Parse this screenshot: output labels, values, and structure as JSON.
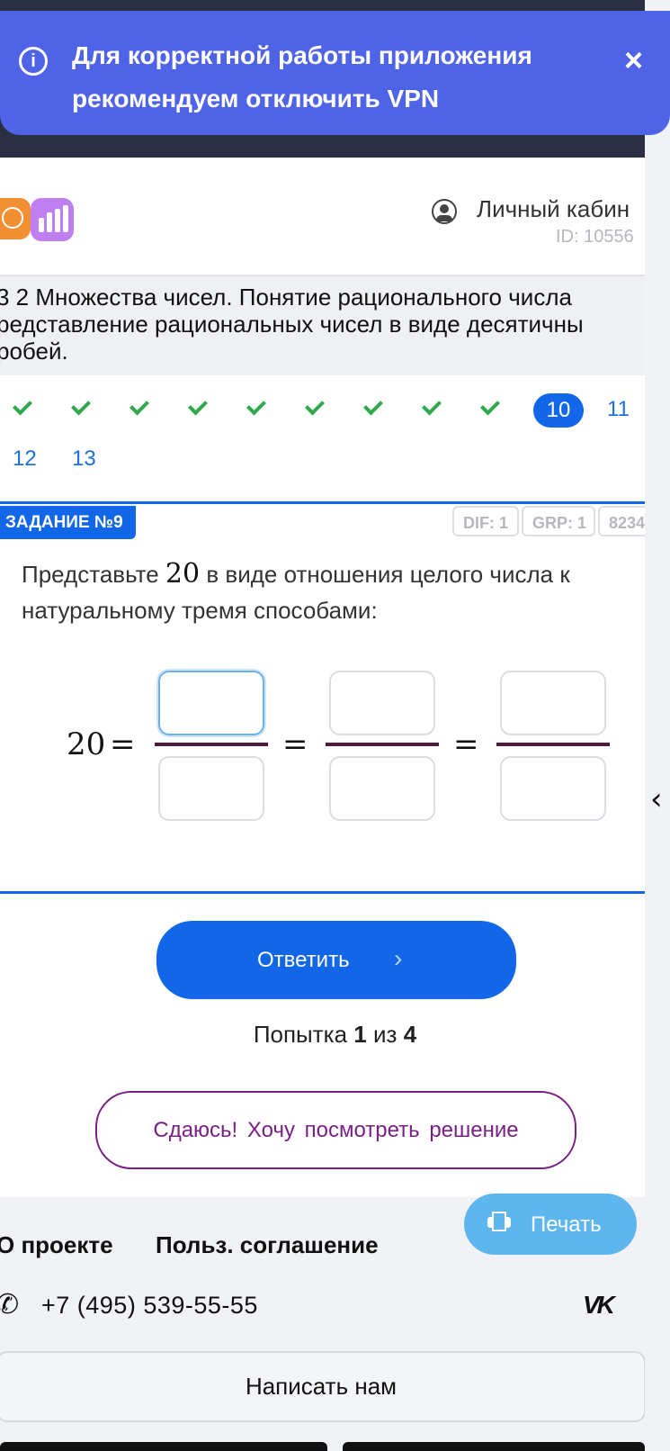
{
  "banner": {
    "message": "Для корректной работы приложения рекомендуем отключить VPN",
    "info_icon": "i",
    "close_icon": "×"
  },
  "header": {
    "account_label": "Личный кабин",
    "account_id": "ID: 10556"
  },
  "lesson": {
    "title_line1": "3 2 Множества чисел. Понятие рационального числа",
    "title_line2": "редставление рациональных чисел в виде десятичны",
    "title_line3": "робей."
  },
  "questions": {
    "current": "10",
    "numbers": [
      "11",
      "12",
      "13"
    ]
  },
  "task": {
    "tag": "ЗАДАНИЕ №9",
    "dif": "DIF: 1",
    "grp": "GRP: 1",
    "code": "8234",
    "text_before": "Представьте",
    "number": "20",
    "text_after": "в виде отношения целого числа к натуральному тремя способами:",
    "lhs": "20",
    "equals": "="
  },
  "actions": {
    "answer_label": "Ответить",
    "answer_chevron": "›",
    "attempt_prefix": "Попытка",
    "attempt_current": "1",
    "attempt_of": "из",
    "attempt_total": "4",
    "give_up_label": "Сдаюсь! Хочу посмотреть решение",
    "print_label": "Печать"
  },
  "footer": {
    "about": "О проекте",
    "agreement": "Польз. соглашение",
    "phone": "+7 (495) 539-55-55",
    "vk": "VK",
    "write_us": "Написать нам"
  },
  "colors": {
    "banner": "#4f63e6",
    "primary": "#1167e8",
    "check": "#2fa84f",
    "giveup": "#7a1f86",
    "print": "#5eb6ef"
  },
  "icons": [
    "info-icon",
    "close-icon",
    "user-icon",
    "check-icon",
    "chevron-right-icon",
    "printer-icon",
    "phone-icon",
    "vk-icon",
    "chevron-left-icon"
  ]
}
